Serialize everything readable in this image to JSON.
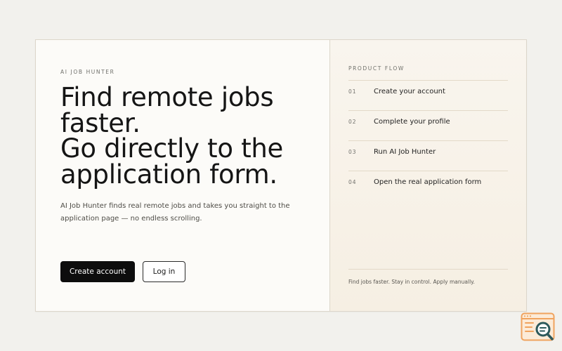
{
  "hero": {
    "eyebrow": "AI JOB HUNTER",
    "headline_lines": [
      "Find remote jobs",
      "faster.",
      "Go directly to the",
      "application form."
    ],
    "subtext": "AI Job Hunter finds real remote jobs and takes you straight to the application page — no endless scrolling.",
    "primary_button": "Create account",
    "secondary_button": "Log in"
  },
  "flow": {
    "title": "PRODUCT FLOW",
    "steps": [
      {
        "num": "01",
        "label": "Create your account"
      },
      {
        "num": "02",
        "label": "Complete your profile"
      },
      {
        "num": "03",
        "label": "Run AI Job Hunter"
      },
      {
        "num": "04",
        "label": "Open the real application form"
      }
    ],
    "footer": "Find jobs faster. Stay in control. Apply manually."
  },
  "colors": {
    "page_bg": "#f2f1ed",
    "card_bg": "#fcfbf8",
    "panel_bg": "#f7f1e7",
    "primary_button_bg": "#0d0d0d",
    "badge_orange": "#f0a35e",
    "badge_teal": "#2e5a5c"
  },
  "icons": {
    "corner_badge": "browser-search-icon"
  }
}
